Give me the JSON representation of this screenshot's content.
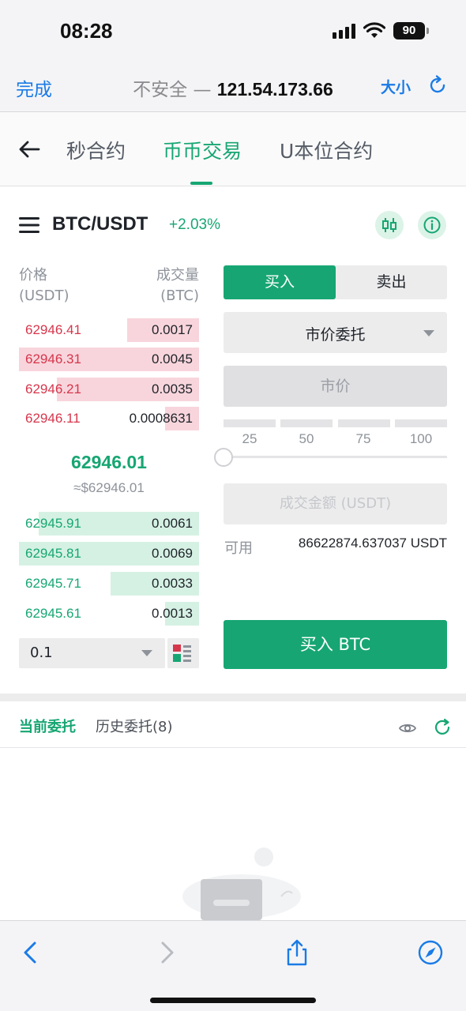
{
  "status_bar": {
    "time": "08:28",
    "battery": "90"
  },
  "browser": {
    "done_label": "完成",
    "insecure_label": "不安全 —",
    "host": "121.54.173.66",
    "text_size_label": "大小"
  },
  "app_tabs": {
    "items": [
      "秒合约",
      "币币交易",
      "U本位合约"
    ],
    "active_index": 1
  },
  "pair": {
    "name": "BTC/USDT",
    "change": "+2.03%"
  },
  "order_book": {
    "price_header": "价格",
    "price_unit": "(USDT)",
    "qty_header": "成交量",
    "qty_unit": "(BTC)",
    "asks": [
      {
        "price": "62946.41",
        "qty": "0.0017",
        "depth": 0.4
      },
      {
        "price": "62946.31",
        "qty": "0.0045",
        "depth": 1.0
      },
      {
        "price": "62946.21",
        "qty": "0.0035",
        "depth": 0.79
      },
      {
        "price": "62946.11",
        "qty": "0.0008631",
        "depth": 0.19
      }
    ],
    "last_price": "62946.01",
    "last_price_fiat": "≈$62946.01",
    "bids": [
      {
        "price": "62945.91",
        "qty": "0.0061",
        "depth": 0.89
      },
      {
        "price": "62945.81",
        "qty": "0.0069",
        "depth": 1.0
      },
      {
        "price": "62945.71",
        "qty": "0.0033",
        "depth": 0.49
      },
      {
        "price": "62945.61",
        "qty": "0.0013",
        "depth": 0.19
      }
    ],
    "depth_precision": "0.1"
  },
  "trade_form": {
    "buy_tab": "买入",
    "sell_tab": "卖出",
    "order_type": "市价委托",
    "price_placeholder": "市价",
    "percent_options": [
      "25",
      "50",
      "75",
      "100"
    ],
    "slider_value": 0,
    "amount_placeholder": "成交金额 (USDT)",
    "available_label": "可用",
    "available_value": "86622874.637037 USDT",
    "submit_label": "买入 BTC"
  },
  "orders": {
    "current_tab": "当前委托",
    "history_tab": "历史委托(8)"
  },
  "colors": {
    "accent_green": "#17a673",
    "ask_red": "#d6364c",
    "ios_blue": "#1a7be6"
  }
}
